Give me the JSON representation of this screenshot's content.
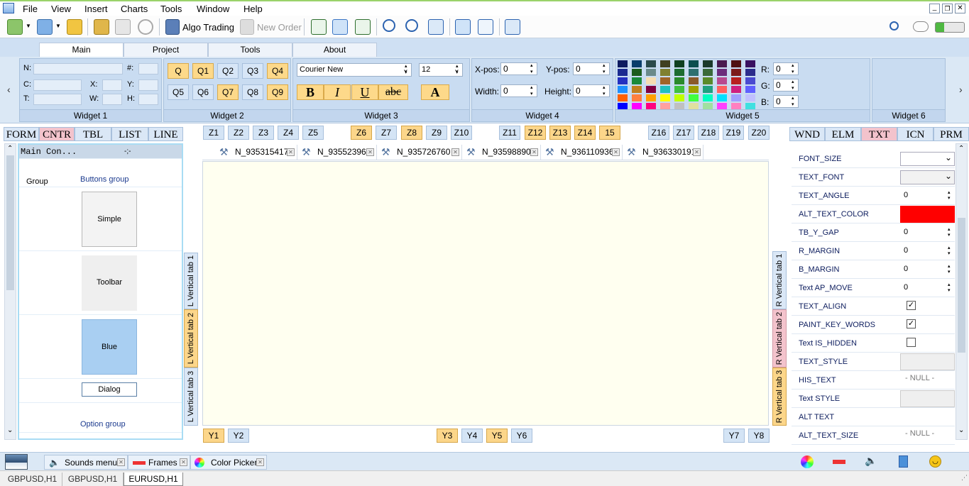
{
  "menu": {
    "file": "File",
    "view": "View",
    "insert": "Insert",
    "charts": "Charts",
    "tools": "Tools",
    "window": "Window",
    "help": "Help"
  },
  "toolbar": {
    "algo_trading": "Algo Trading",
    "new_order": "New Order"
  },
  "ribbon_tabs": [
    "Main",
    "Project",
    "Tools",
    "About"
  ],
  "widget1": {
    "caption": "Widget 1",
    "n_label": "N:",
    "hash_label": "#:",
    "c_label": "C:",
    "x_label": "X:",
    "y_label": "Y:",
    "t_label": "T:",
    "w_label": "W:",
    "h_label": "H:"
  },
  "widget2": {
    "caption": "Widget 2",
    "buttons": [
      "Q",
      "Q1",
      "Q2",
      "Q3",
      "Q4",
      "Q5",
      "Q6",
      "Q7",
      "Q8",
      "Q9"
    ]
  },
  "widget3": {
    "caption": "Widget 3",
    "font": "Courier New",
    "size": "12",
    "bold": "B",
    "italic": "I",
    "underline": "U",
    "strike": "abc",
    "color_a": "A"
  },
  "widget4": {
    "caption": "Widget 4",
    "xpos_label": "X-pos:",
    "xpos": "0",
    "ypos_label": "Y-pos:",
    "ypos": "0",
    "width_label": "Width:",
    "width": "0",
    "height_label": "Height:",
    "height": "0"
  },
  "widget5": {
    "caption": "Widget 5",
    "r_label": "R:",
    "r": "0",
    "g_label": "G:",
    "g": "0",
    "b_label": "B:",
    "b": "0"
  },
  "widget6": {
    "caption": "Widget 6"
  },
  "left_tabs": [
    "FORM",
    "CNTR",
    "TBL",
    "LIST",
    "LINE"
  ],
  "z_buttons": [
    "Z1",
    "Z2",
    "Z3",
    "Z4",
    "Z5",
    "Z6",
    "Z7",
    "Z8",
    "Z9",
    "Z10",
    "Z11",
    "Z12",
    "Z13",
    "Z14",
    "15",
    "Z16",
    "Z17",
    "Z18",
    "Z19",
    "Z20"
  ],
  "y_buttons": [
    "Y1",
    "Y2",
    "Y3",
    "Y4",
    "Y5",
    "Y6",
    "Y7",
    "Y8"
  ],
  "right_tabs": [
    "WND",
    "ELM",
    "TXT",
    "ICN",
    "PRM"
  ],
  "left_panel": {
    "header": "Main Con...",
    "header_value": "-;-",
    "group_label": "Group",
    "buttons_group": "Buttons group",
    "simple": "Simple",
    "toolbar": "Toolbar",
    "blue": "Blue",
    "dialog": "Dialog",
    "option_group": "Option group"
  },
  "left_vertical_tabs": [
    "L Vertical tab 1",
    "L Vertical tab 2",
    "L Vertical tab 3"
  ],
  "right_vertical_tabs": [
    "R Vertical tab 1",
    "R Vertical tab 2",
    "R Vertical tab 3"
  ],
  "doc_tabs": [
    "N_935315417",
    "N_93552396",
    "N_935726760",
    "N_93598890",
    "N_936110936",
    "N_936330191"
  ],
  "properties": [
    {
      "name": "FONT_SIZE",
      "value": ""
    },
    {
      "name": "TEXT_FONT",
      "value": ""
    },
    {
      "name": "TEXT_ANGLE",
      "value": "0"
    },
    {
      "name": "ALT_TEXT_COLOR",
      "value": ""
    },
    {
      "name": "TB_Y_GAP",
      "value": "0"
    },
    {
      "name": "R_MARGIN",
      "value": "0"
    },
    {
      "name": "B_MARGIN",
      "value": "0"
    },
    {
      "name": "Text AP_MOVE",
      "value": "0"
    },
    {
      "name": "TEXT_ALIGN",
      "value": "✓"
    },
    {
      "name": "PAINT_KEY_WORDS",
      "value": "✓"
    },
    {
      "name": "Text IS_HIDDEN",
      "value": ""
    },
    {
      "name": "TEXT_STYLE",
      "value": ""
    },
    {
      "name": "HIS_TEXT",
      "value": "- NULL -"
    },
    {
      "name": "Text STYLE",
      "value": ""
    },
    {
      "name": "ALT TEXT",
      "value": ""
    },
    {
      "name": "ALT_TEXT_SIZE",
      "value": "- NULL -"
    }
  ],
  "bottom_tabs": [
    "Sounds menu",
    "Frames",
    "Color Picker"
  ],
  "status_tabs": [
    "GBPUSD,H1",
    "GBPUSD,H1",
    "EURUSD,H1"
  ],
  "colors": {
    "accent_yellow": "#fcd68a",
    "accent_pink": "#f3c3cc",
    "alt_text_color": "#ff0000",
    "canvas": "#fffff0",
    "panel_blue": "#dbe8f5"
  }
}
